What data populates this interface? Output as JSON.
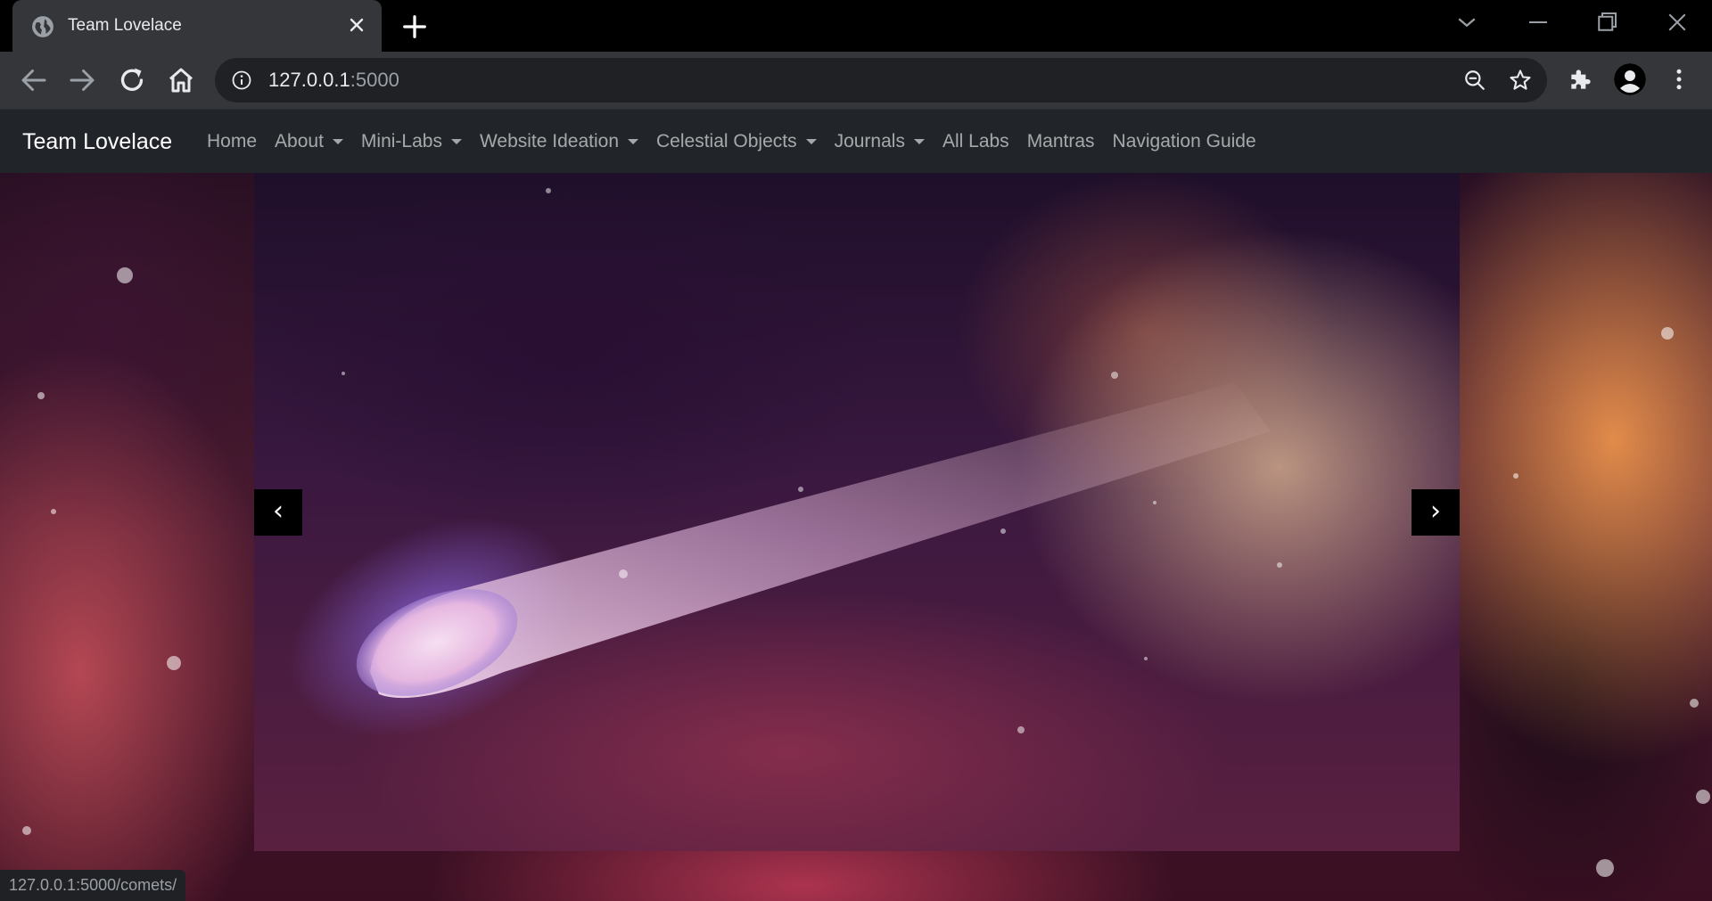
{
  "browser": {
    "tab_title": "Team Lovelace",
    "url_host": "127.0.0.1",
    "url_port": ":5000",
    "status_url": "127.0.0.1:5000/comets/"
  },
  "navbar": {
    "brand": "Team Lovelace",
    "links": [
      {
        "label": "Home",
        "dropdown": false
      },
      {
        "label": "About",
        "dropdown": true
      },
      {
        "label": "Mini-Labs",
        "dropdown": true
      },
      {
        "label": "Website Ideation",
        "dropdown": true
      },
      {
        "label": "Celestial Objects",
        "dropdown": true
      },
      {
        "label": "Journals",
        "dropdown": true
      },
      {
        "label": "All Labs",
        "dropdown": false
      },
      {
        "label": "Mantras",
        "dropdown": false
      },
      {
        "label": "Navigation Guide",
        "dropdown": false
      }
    ]
  },
  "carousel": {
    "prev_label": "‹",
    "next_label": "›"
  },
  "colors": {
    "navbar_bg": "#212529",
    "chrome_bg": "#35363a",
    "omnibox_bg": "#202124"
  }
}
